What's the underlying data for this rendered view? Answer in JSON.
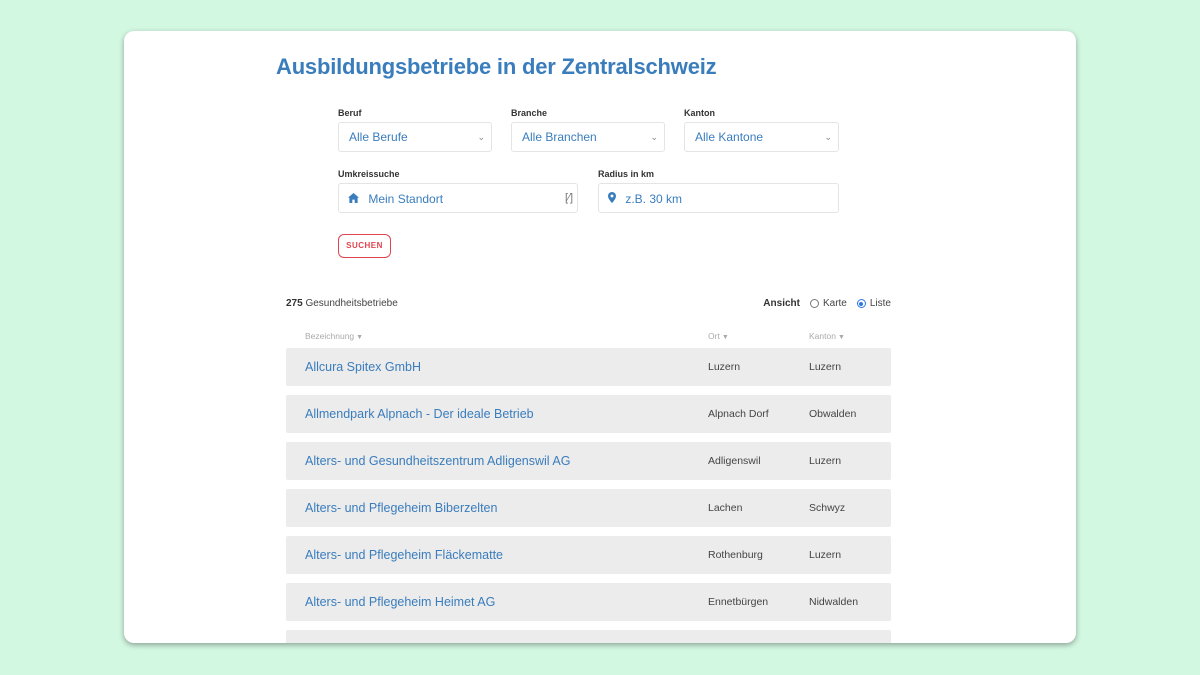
{
  "page": {
    "title": "Ausbildungsbetriebe in der Zentralschweiz"
  },
  "filters": {
    "beruf": {
      "label": "Beruf",
      "value": "Alle Berufe"
    },
    "branche": {
      "label": "Branche",
      "value": "Alle Branchen"
    },
    "kanton": {
      "label": "Kanton",
      "value": "Alle Kantone"
    },
    "umkreis": {
      "label": "Umkreissuche",
      "value": "Mein Standort",
      "icon": "home-icon"
    },
    "radius": {
      "label": "Radius in km",
      "placeholder": "z.B. 30 km",
      "icon": "map-marker-icon"
    },
    "search_label": "SUCHEN"
  },
  "results": {
    "count": "275",
    "count_suffix": "Gesundheitsbetriebe",
    "view_label": "Ansicht",
    "view_options": [
      "Karte",
      "Liste"
    ],
    "view_selected": "Liste"
  },
  "table": {
    "headers": [
      "Bezeichnung",
      "Ort",
      "Kanton"
    ],
    "rows": [
      {
        "name": "Allcura Spitex GmbH",
        "ort": "Luzern",
        "kanton": "Luzern"
      },
      {
        "name": "Allmendpark Alpnach - Der ideale Betrieb",
        "ort": "Alpnach Dorf",
        "kanton": "Obwalden"
      },
      {
        "name": "Alters- und Gesundheitszentrum Adligenswil AG",
        "ort": "Adligenswil",
        "kanton": "Luzern"
      },
      {
        "name": "Alters- und Pflegeheim Biberzelten",
        "ort": "Lachen",
        "kanton": "Schwyz"
      },
      {
        "name": "Alters- und Pflegeheim Fläckematte",
        "ort": "Rothenburg",
        "kanton": "Luzern"
      },
      {
        "name": "Alters- und Pflegeheim Heimet AG",
        "ort": "Ennetbürgen",
        "kanton": "Nidwalden"
      }
    ]
  },
  "colors": {
    "accent": "#3a7dbd",
    "button": "#e0444f",
    "row_bg": "#ececec",
    "background": "#d3f8e2"
  }
}
